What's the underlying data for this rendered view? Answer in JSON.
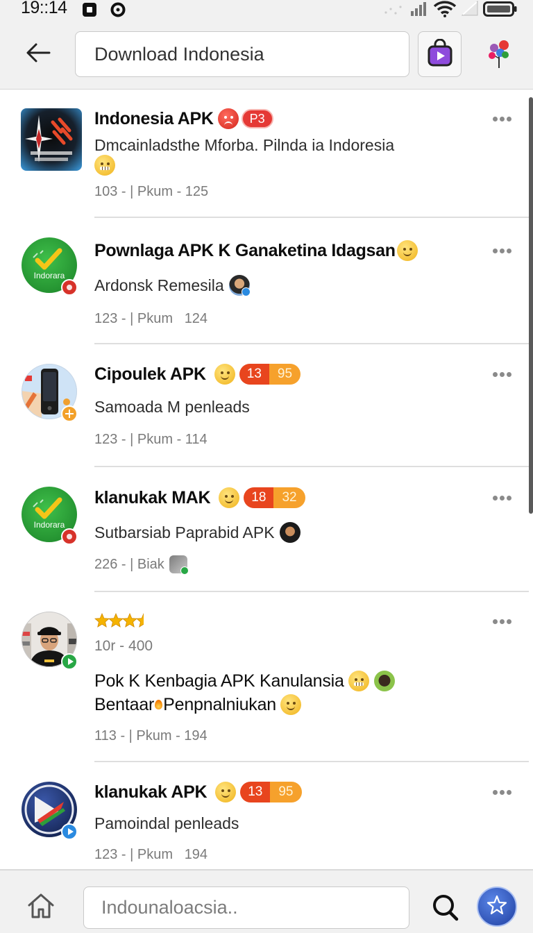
{
  "status_bar": {
    "time": "19::14"
  },
  "header": {
    "search_value": "Download Indonesia",
    "back_icon": "back-arrow-icon",
    "store_icon": "play-store-bag-icon",
    "extra_icon": "balloons-icon"
  },
  "results": [
    {
      "icon": "compass-app-icon",
      "title": "Indonesia APK",
      "badge": "P3",
      "subtitle": "Dmcainladsthe Mforba. Pilnda ia Indoresia",
      "meta": "103 - | Pkum - 125"
    },
    {
      "icon": "check-app-icon",
      "logo_text": "Indorara",
      "title": "Pownlaga APK K Ganaketina Idagsan",
      "subtitle": "Ardonsk Remesila",
      "meta": "123 - | Pkum   124"
    },
    {
      "icon": "phone-app-icon",
      "title": "Cipoulek APK",
      "badge_left": "13",
      "badge_right": "95",
      "subtitle": "Samoada M penleads",
      "meta": "123 - | Pkum - 114"
    },
    {
      "icon": "check-app-icon",
      "logo_text": "Indorara",
      "title": "klanukak MAK",
      "badge_left": "18",
      "badge_right": "32",
      "subtitle": "Sutbarsiab Paprabid APK",
      "meta": "226 - | Biak"
    },
    {
      "icon": "person-avatar-icon",
      "rating": 3.5,
      "rating_text": "10r - 400",
      "title": "Pok K Kenbagia APK Kanulansia",
      "subtitle_parts": [
        "Bentaar",
        "Penpnalniukan"
      ],
      "meta": "113 - | Pkum - 194"
    },
    {
      "icon": "arrow-app-icon",
      "title": "klanukak APK",
      "badge_left": "13",
      "badge_right": "95",
      "subtitle": "Pamoindal penleads",
      "meta": "123 - | Pkum   194"
    }
  ],
  "bottom_bar": {
    "input_placeholder": "Indounaloacsia..",
    "home_icon": "home-icon",
    "search_icon": "search-icon",
    "assistant_icon": "star-assistant-icon"
  },
  "colors": {
    "badge_red": "#e8451e",
    "badge_orange": "#f6a12c",
    "star_gold": "#f5b301",
    "assistant_blue": "#1f3fa0"
  }
}
